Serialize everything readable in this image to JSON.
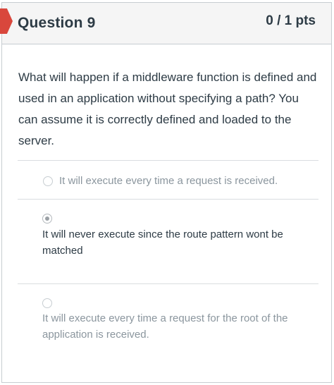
{
  "question": {
    "title": "Question 9",
    "points": "0 / 1 pts",
    "text": "What will happen if a middleware function is defined and used in an application without specifying a path? You can assume it is correctly defined and loaded to the server."
  },
  "answers": [
    {
      "label": "It will execute every time a request is received.",
      "selected": false
    },
    {
      "label": "It will never execute since the route pattern wont be matched",
      "selected": true
    },
    {
      "label": "It will execute every time a request for the root of the application is received.",
      "selected": false
    }
  ],
  "colors": {
    "flag": "#d9473c",
    "text": "#2d3b45",
    "muted_text": "#8b969e",
    "header_bg": "#f5f5f5"
  }
}
